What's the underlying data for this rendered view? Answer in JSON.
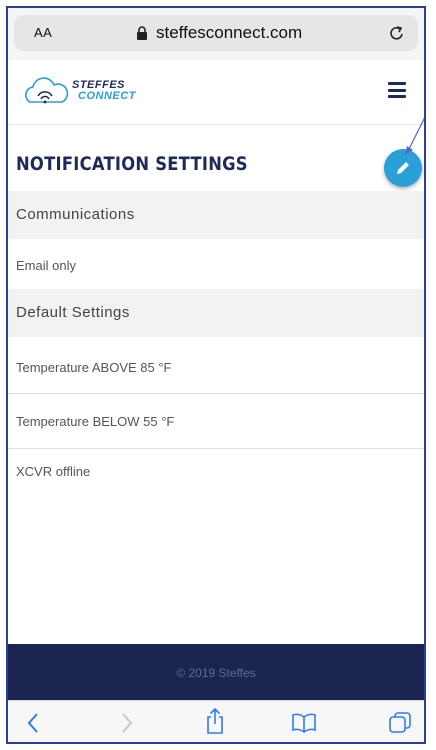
{
  "browser": {
    "text_size_label": "AA",
    "url": "steffesconnect.com"
  },
  "header": {
    "logo_line1": "STEFFES",
    "logo_line2": "CONNECT"
  },
  "page": {
    "title": "NOTIFICATION SETTINGS"
  },
  "sections": {
    "communications": {
      "label": "Communications",
      "value": "Email only"
    },
    "defaults": {
      "label": "Default Settings",
      "items": [
        "Temperature ABOVE 85 °F",
        "Temperature BELOW 55 °F",
        "XCVR offline"
      ]
    }
  },
  "footer": {
    "copyright": "© 2019 Steffes"
  },
  "colors": {
    "brand_navy": "#1e2a5a",
    "accent_blue": "#2b9fd8",
    "footer_bg": "#1a2650"
  },
  "icons": [
    "lock-icon",
    "reload-icon",
    "logo-icon",
    "hamburger-icon",
    "edit-icon",
    "back-icon",
    "forward-icon",
    "share-icon",
    "bookmarks-icon",
    "tabs-icon"
  ]
}
